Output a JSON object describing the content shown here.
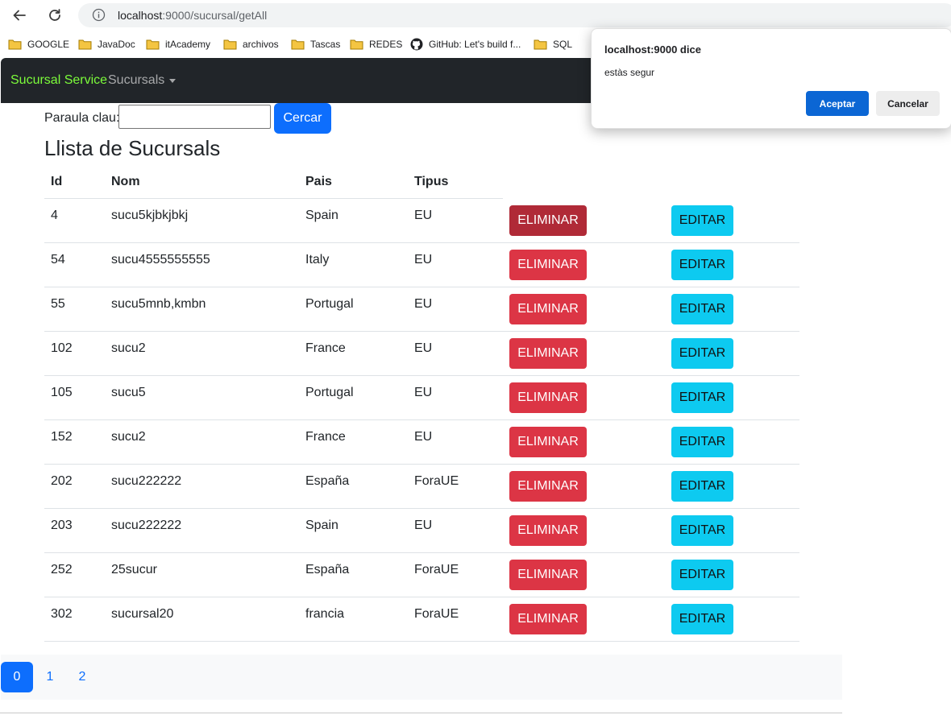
{
  "browser": {
    "url_host": "localhost",
    "url_rest": ":9000/sucursal/getAll",
    "bookmarks": [
      {
        "label": "GOOGLE",
        "icon": "folder-icon"
      },
      {
        "label": "JavaDoc",
        "icon": "folder-icon"
      },
      {
        "label": "itAcademy",
        "icon": "folder-icon"
      },
      {
        "label": "archivos",
        "icon": "folder-icon"
      },
      {
        "label": "Tascas",
        "icon": "folder-icon"
      },
      {
        "label": "REDES",
        "icon": "folder-icon"
      },
      {
        "label": "GitHub: Let's build f...",
        "icon": "github-icon"
      },
      {
        "label": "SQL",
        "icon": "folder-icon"
      }
    ]
  },
  "navbar": {
    "brand": "Sucursal Service",
    "dropdown": "Sucursals"
  },
  "search": {
    "label": "Paraula clau:",
    "value": "",
    "button": "Cercar"
  },
  "page_title": "Llista de Sucursals",
  "table": {
    "headers": [
      "Id",
      "Nom",
      "Pais",
      "Tipus"
    ],
    "delete_label": "ELIMINAR",
    "edit_label": "EDITAR",
    "rows": [
      {
        "id": "4",
        "nom": "sucu5kjbkjbkj",
        "pais": "Spain",
        "tipus": "EU"
      },
      {
        "id": "54",
        "nom": "sucu4555555555",
        "pais": "Italy",
        "tipus": "EU"
      },
      {
        "id": "55",
        "nom": "sucu5mnb,kmbn",
        "pais": "Portugal",
        "tipus": "EU"
      },
      {
        "id": "102",
        "nom": "sucu2",
        "pais": "France",
        "tipus": "EU"
      },
      {
        "id": "105",
        "nom": "sucu5",
        "pais": "Portugal",
        "tipus": "EU"
      },
      {
        "id": "152",
        "nom": "sucu2",
        "pais": "France",
        "tipus": "EU"
      },
      {
        "id": "202",
        "nom": "sucu222222",
        "pais": "España",
        "tipus": "ForaUE"
      },
      {
        "id": "203",
        "nom": "sucu222222",
        "pais": "Spain",
        "tipus": "EU"
      },
      {
        "id": "252",
        "nom": "25sucur",
        "pais": "España",
        "tipus": "ForaUE"
      },
      {
        "id": "302",
        "nom": "sucursal20",
        "pais": "francia",
        "tipus": "ForaUE"
      }
    ]
  },
  "pagination": {
    "pages": [
      "0",
      "1",
      "2"
    ],
    "current": "0"
  },
  "dialog": {
    "title": "localhost:9000 dice",
    "message": "estàs segur",
    "ok": "Aceptar",
    "cancel": "Cancelar"
  },
  "colors": {
    "primary": "#0d6efd",
    "danger": "#dc3545",
    "info": "#0dcaf0",
    "navbar": "#212529",
    "brand": "#7cfc3a"
  }
}
